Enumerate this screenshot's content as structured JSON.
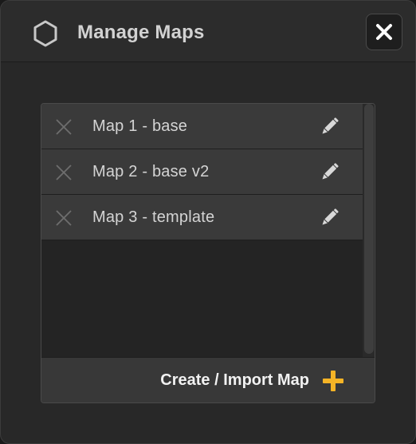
{
  "dialog": {
    "title": "Manage Maps",
    "icon": "hexagon-icon",
    "close_icon": "close-icon"
  },
  "maps": [
    {
      "label": "Map 1 - base"
    },
    {
      "label": "Map 2 - base v2"
    },
    {
      "label": "Map 3 - template"
    }
  ],
  "footer": {
    "create_label": "Create / Import Map",
    "plus_icon": "plus-icon"
  },
  "colors": {
    "accent": "#f5b426",
    "panel_bg": "#242424",
    "row_bg": "#3a3a3a",
    "text": "#d4d4d4"
  }
}
